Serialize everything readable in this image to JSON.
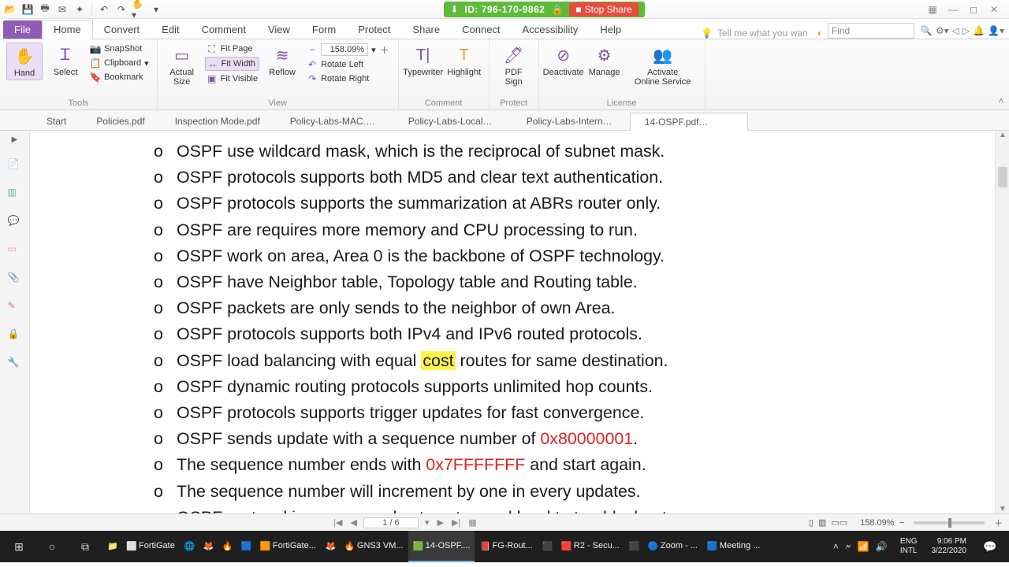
{
  "share": {
    "id": "ID: 796-170-9862",
    "stop": "Stop Share"
  },
  "menu": {
    "file": "File",
    "home": "Home",
    "convert": "Convert",
    "edit": "Edit",
    "comment": "Comment",
    "view": "View",
    "form": "Form",
    "protect": "Protect",
    "share": "Share",
    "connect": "Connect",
    "accessibility": "Accessibility",
    "help": "Help",
    "tellme": "Tell me what you wan",
    "find": "Find"
  },
  "ribbon": {
    "tools": {
      "hand": "Hand",
      "select": "Select",
      "snapshot": "SnapShot",
      "clipboard": "Clipboard",
      "bookmark": "Bookmark",
      "label": "Tools"
    },
    "view": {
      "actual": "Actual\nSize",
      "fitpage": "Fit Page",
      "fitwidth": "Fit Width",
      "fitvisible": "Fit Visible",
      "reflow": "Reflow",
      "rotleft": "Rotate Left",
      "rotright": "Rotate Right",
      "zoom": "158.09%",
      "label": "View"
    },
    "comment": {
      "typewriter": "Typewriter",
      "highlight": "Highlight",
      "label": "Comment"
    },
    "protect": {
      "pdfsign": "PDF\nSign",
      "label": "Protect"
    },
    "license": {
      "deactivate": "Deactivate",
      "manage": "Manage",
      "activate": "Activate\nOnline Service",
      "label": "License"
    }
  },
  "tabs": {
    "start": "Start",
    "items": [
      "Policies.pdf",
      "Inspection Mode.pdf",
      "Policy-Labs-MAC.pdf",
      "Policy-Labs-LocalUser....",
      "Policy-Labs-Internet S...",
      "14-OSPF.pdf"
    ],
    "active": 5
  },
  "doc": {
    "lines": [
      {
        "t": "OSPF use wildcard mask, which is the reciprocal of subnet mask."
      },
      {
        "t": "OSPF  protocols supports both MD5 and clear text authentication."
      },
      {
        "t": "OSPF protocols supports the summarization at ABRs router only."
      },
      {
        "t": "OSPF are requires more memory and CPU processing to run."
      },
      {
        "t": "OSPF work on area, Area 0 is the backbone of OSPF technology."
      },
      {
        "t": "OSPF have Neighbor table, Topology table and Routing table."
      },
      {
        "t": "OSPF packets are only sends to the neighbor of own Area."
      },
      {
        "t": "OSPF protocols supports both IPv4 and IPv6 routed protocols."
      },
      {
        "pre": "OSPF load balancing with equal ",
        "hl": "cost",
        "post": " routes for same destination."
      },
      {
        "t": "OSPF dynamic routing protocols supports unlimited hop counts."
      },
      {
        "t": "OSPF protocols supports trigger updates for fast convergence."
      },
      {
        "pre": "OSPF sends update with a sequence number of ",
        "red": "0x80000001",
        "post": "."
      },
      {
        "pre": "The sequence number ends with ",
        "red": "0x7FFFFFFF",
        "post": " and start again."
      },
      {
        "t": "The sequence number will increment by one in every updates."
      },
      {
        "t": "OSPF protocol is more complex to setup and hard to troubleshoot"
      }
    ]
  },
  "status": {
    "page": "1 / 6",
    "zoom": "158.09%"
  },
  "taskbar": {
    "items": [
      "FortiGate",
      "",
      "",
      "FortiGate...",
      "GNS3 VM...",
      "14-OSPF....",
      "FG-Rout...",
      "R2 - Secu...",
      "Zoom - ...",
      "Meeting ..."
    ],
    "lang": "ENG",
    "kb": "INTL",
    "time": "9:06 PM",
    "date": "3/22/2020"
  }
}
